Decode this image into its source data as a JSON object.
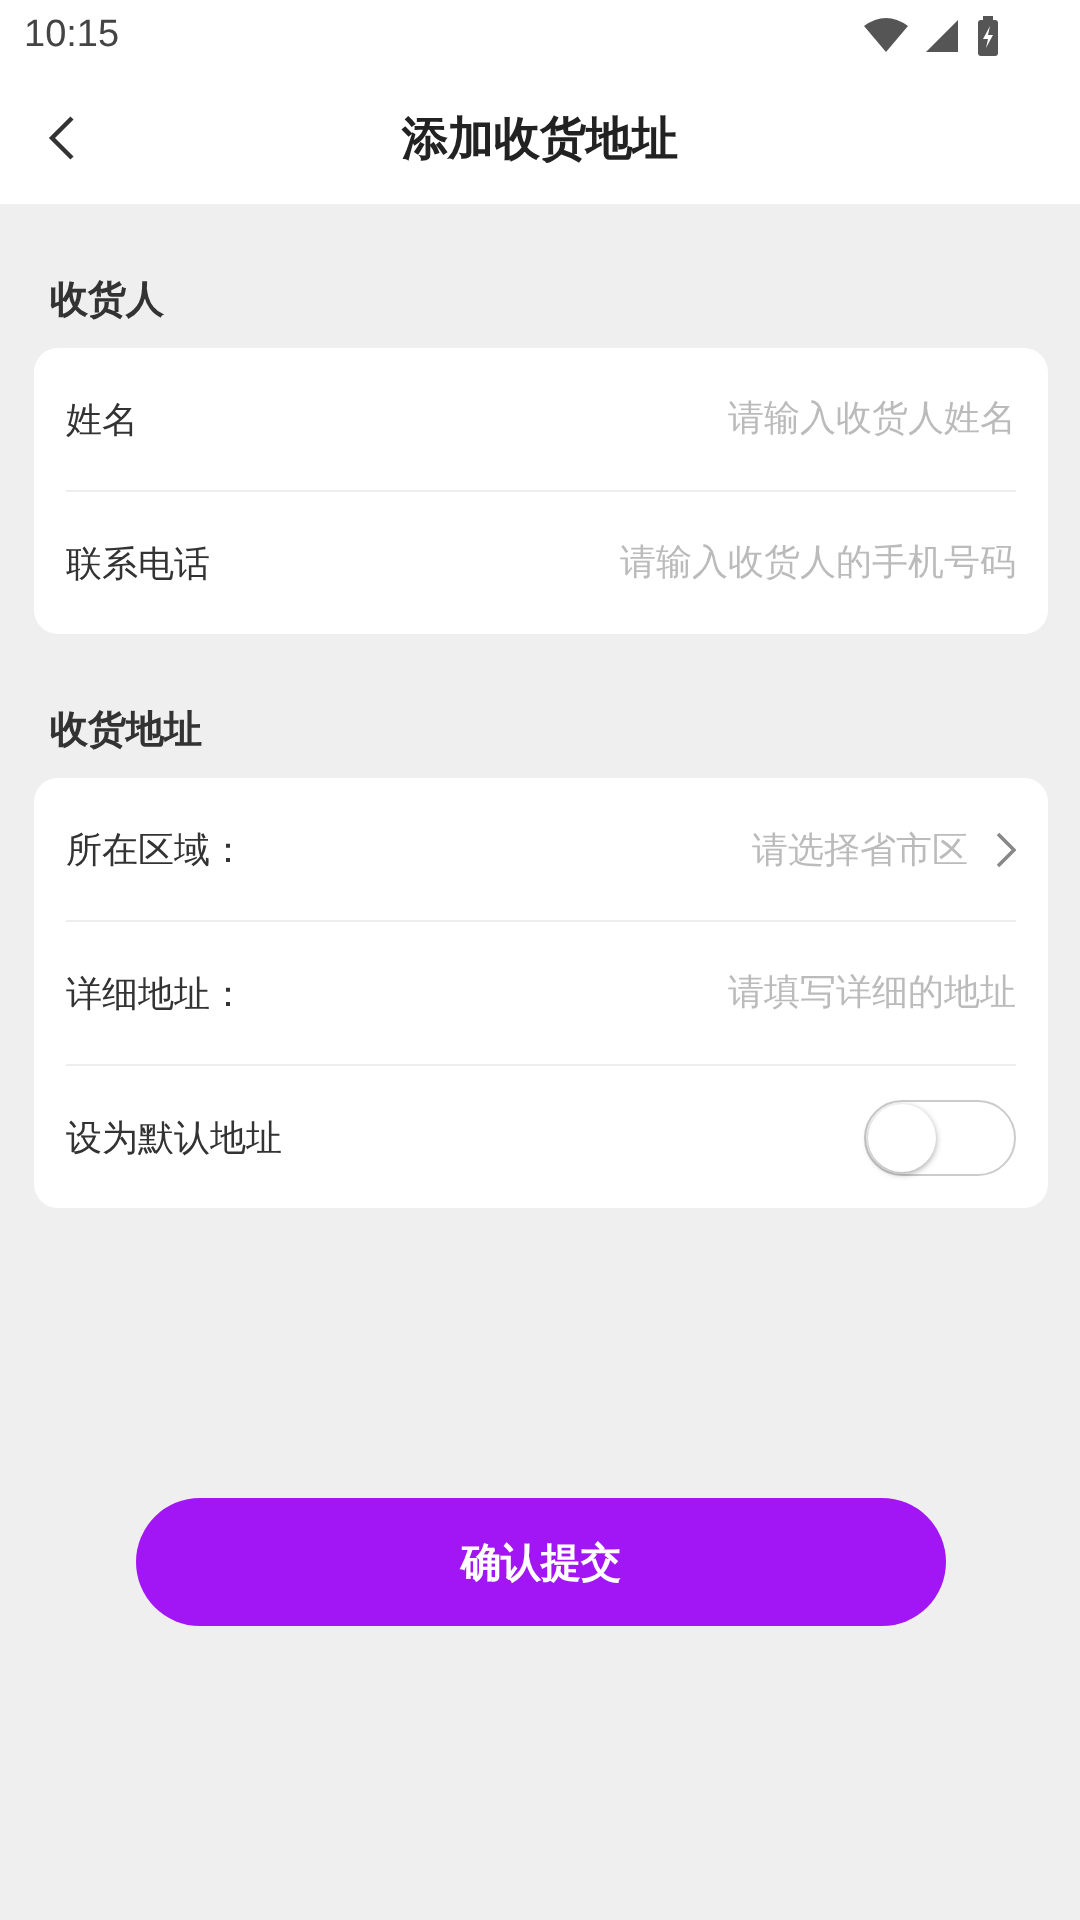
{
  "status_bar": {
    "time": "10:15"
  },
  "header": {
    "title": "添加收货地址"
  },
  "sections": [
    {
      "title": "收货人",
      "rows": [
        {
          "kind": "input",
          "label": "姓名",
          "placeholder": "请输入收货人姓名"
        },
        {
          "kind": "input",
          "label": "联系电话",
          "placeholder": "请输入收货人的手机号码"
        }
      ]
    },
    {
      "title": "收货地址",
      "rows": [
        {
          "kind": "select",
          "label": "所在区域：",
          "placeholder": "请选择省市区"
        },
        {
          "kind": "input",
          "label": "详细地址：",
          "placeholder": "请填写详细的地址"
        },
        {
          "kind": "toggle",
          "label": "设为默认地址",
          "on": false
        }
      ]
    }
  ],
  "submit": {
    "label": "确认提交"
  }
}
